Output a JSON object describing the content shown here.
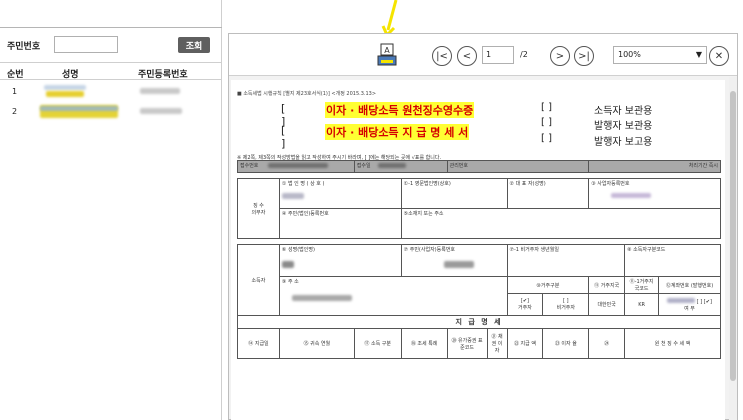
{
  "left_panel": {
    "search_label": "주민번호",
    "search_value": "",
    "search_button": "조회",
    "columns": [
      "순번",
      "성명",
      "주민등록번호"
    ],
    "rows": [
      {
        "no": "1"
      },
      {
        "no": "2"
      }
    ]
  },
  "viewer": {
    "page_current": "1",
    "page_total": "/2",
    "zoom": "100%",
    "print_label": "A"
  },
  "document": {
    "ref": "■ 소득세법 시행규칙 [별지 제23호서식(1)] <개정 2015.3.13>",
    "titles": [
      {
        "bracket": "[     ]",
        "text": "이자 · 배당소득 원천징수영수증"
      },
      {
        "bracket": "[     ]",
        "text": "이자 · 배당소득 지 급 명 세 서"
      }
    ],
    "copies": [
      {
        "bracket": "[     ]",
        "label": "소득자 보관용"
      },
      {
        "bracket": "[     ]",
        "label": "발행자 보관용"
      },
      {
        "bracket": "[     ]",
        "label": "발행자 보고용"
      }
    ],
    "note": "※ 제2쪽, 제3쪽의 작성방법을 읽고 작성하여 주시기 바라며, [ ]에는 해당되는 곳에 √표를 합니다.",
    "row_top": {
      "c1": "접수번호",
      "c2": "접수일",
      "c3": "관리번호",
      "c4": "처리기간  즉시"
    },
    "payer": {
      "side": "징 수\n의무자",
      "f1": "① 법 인 명 ( 상 호 )",
      "f1b": "①-1 영문법인명(상호)",
      "f2": "② 대 표 자(성명)",
      "f3": "③ 사업자등록번호",
      "f4": "④ 주민(법인)등록번호",
      "f5": "⑤소재지 또는 주소"
    },
    "recipient": {
      "side": "소득자",
      "f6": "⑥ 성명(법인명)",
      "f7": "⑦ 주민(사업자)등록번호",
      "f7b": "⑦-1 비거주자 생년월일",
      "f8": "⑧ 소득자구분코드",
      "f9": "⑨ 주    소",
      "f10": "⑩거주구분",
      "f11": "⑪ 거주지국",
      "f11b": "⑪-1거주지 국코드",
      "f12": "⑫계좌번호 (발행번호)",
      "f13": "⑬신탁이익 여부",
      "res_check": "[✔]",
      "nonres_check": "[   ]",
      "res_label": "거주자",
      "nonres_label": "비거주자",
      "country": "대한민국",
      "country_code": "KR",
      "trust_opts": "[  ] [✔]",
      "trust_labels": "여    부"
    },
    "detail": {
      "title": "지 급 명 세",
      "c14": "⑭ 지급일",
      "c15": "⑮ 귀속 연월",
      "c16": "⑯",
      "c17": "⑰ 소득 구분",
      "c18": "⑱ 조세 특례",
      "c19": "⑲ 금융 상품",
      "c20": "⑳ 유가증권 표준코드",
      "c21": "㉑ 채권 이자",
      "c22": "㉒ 지급 액",
      "c23": "㉓ 이자 율",
      "c24": "㉔",
      "c25": "㉕",
      "tax": "원 천 징 수 세 액"
    }
  }
}
